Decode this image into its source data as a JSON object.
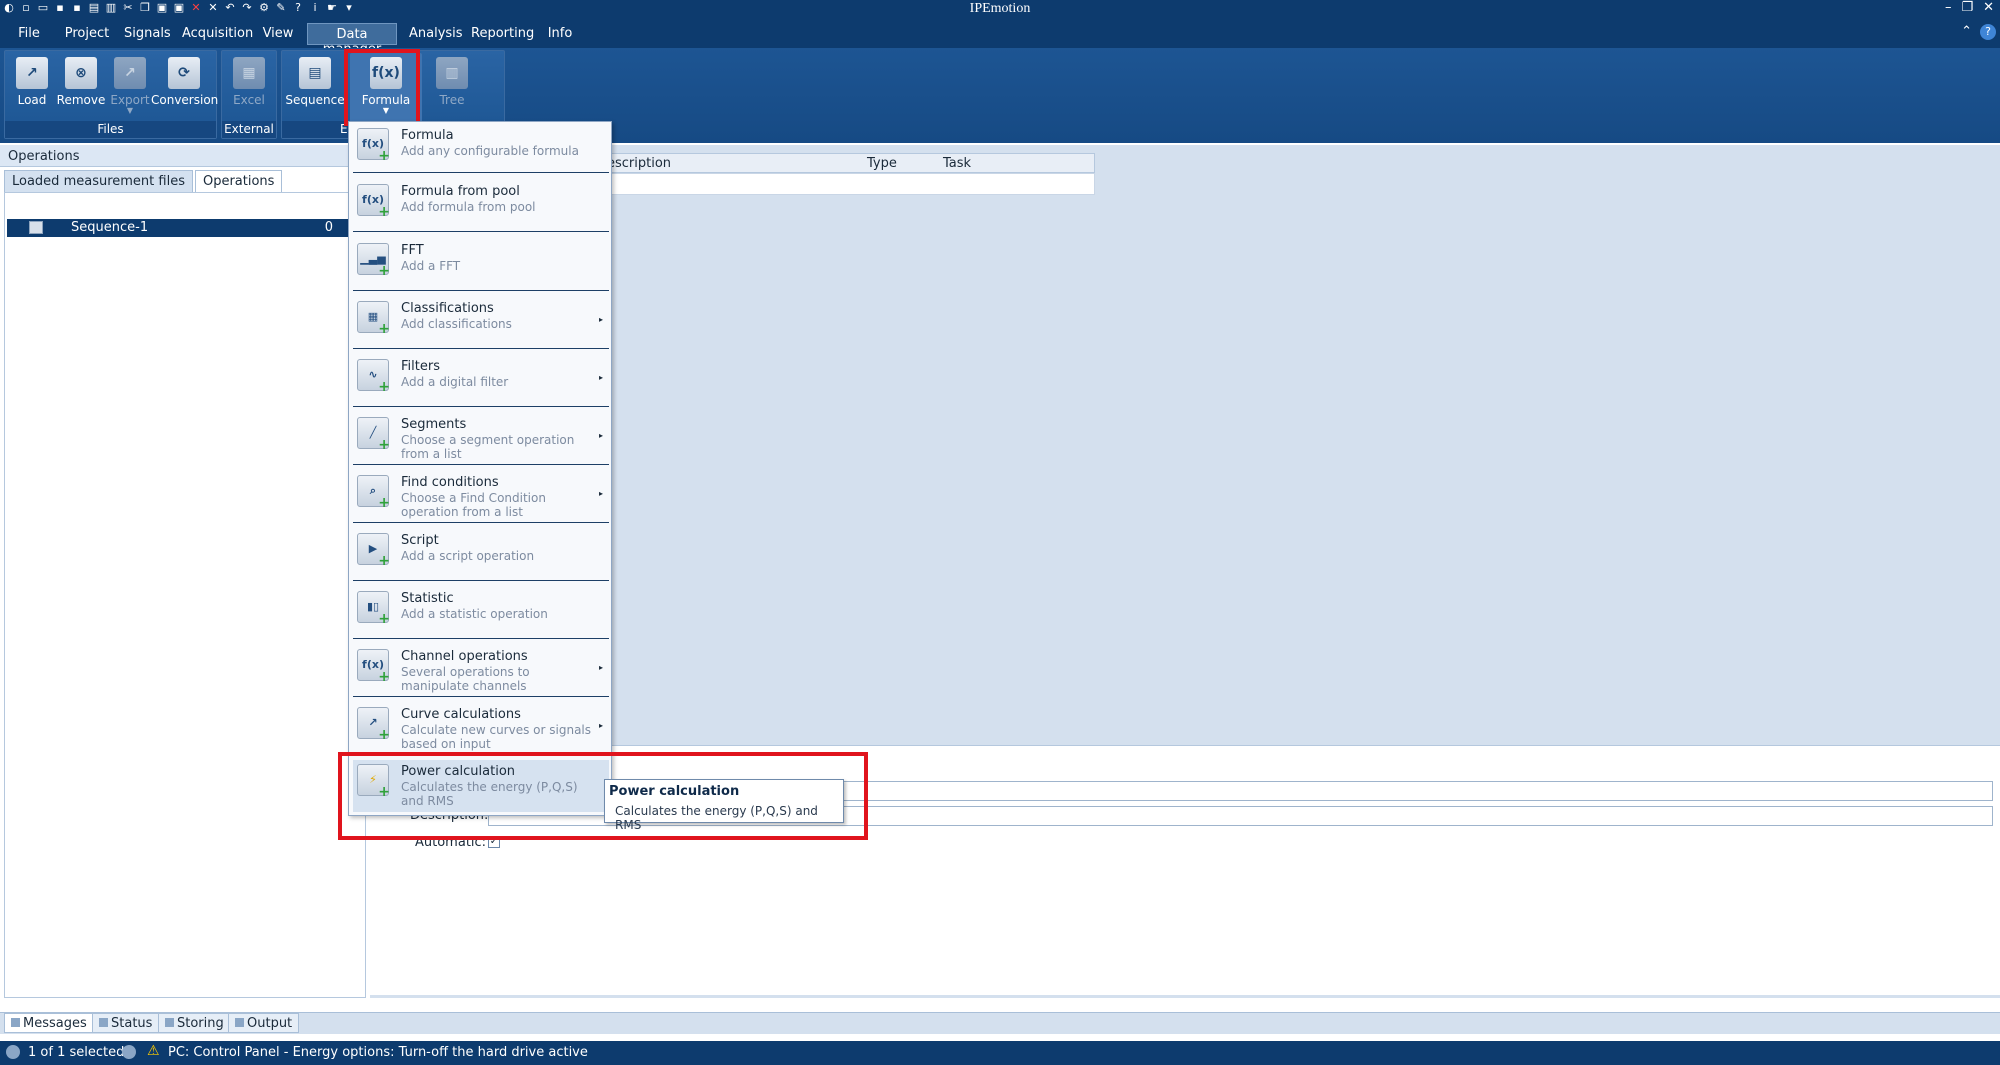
{
  "app": {
    "title": "IPEmotion",
    "window_controls": [
      "–",
      "❐",
      "✕"
    ]
  },
  "menu": {
    "items": [
      {
        "label": "File"
      },
      {
        "label": "Project"
      },
      {
        "label": "Signals"
      },
      {
        "label": "Acquisition"
      },
      {
        "label": "View"
      },
      {
        "label": "Data manager"
      },
      {
        "label": "Analysis"
      },
      {
        "label": "Reporting"
      },
      {
        "label": "Info"
      }
    ],
    "active": "Data manager"
  },
  "ribbon": {
    "groups": [
      {
        "label": "Files",
        "buttons": [
          {
            "label": "Load",
            "icon": "load-icon",
            "glyph": "↗"
          },
          {
            "label": "Remove",
            "icon": "remove-icon",
            "glyph": "⊗"
          },
          {
            "label": "Export",
            "icon": "export-icon",
            "glyph": "↗"
          },
          {
            "label": "Conversion",
            "icon": "conversion-icon",
            "glyph": "⟳"
          }
        ]
      },
      {
        "label": "External",
        "buttons": [
          {
            "label": "Excel",
            "icon": "excel-icon",
            "glyph": "▦"
          }
        ]
      },
      {
        "label": "E",
        "buttons": [
          {
            "label": "Sequence",
            "icon": "sequence-icon",
            "glyph": "▤"
          },
          {
            "label": "Formula",
            "icon": "formula-icon",
            "glyph": "f(x)"
          },
          {
            "label": "Tree",
            "icon": "tree-icon",
            "glyph": "▥"
          }
        ]
      }
    ]
  },
  "left_panel": {
    "header": "Operations",
    "tabs": [
      "Loaded measurement files",
      "Operations"
    ],
    "rows": [
      {
        "name": "Sequence-1",
        "count": "0"
      }
    ]
  },
  "table": {
    "columns": [
      "escription",
      "Type",
      "Task"
    ]
  },
  "properties": {
    "description_label": "Description:",
    "automatic_label": "Automatic:",
    "automatic_checked": "✓"
  },
  "dropdown": {
    "items": [
      {
        "title": "Formula",
        "desc": "Add any configurable formula",
        "glyph": "f(x)",
        "arrow": ""
      },
      {
        "title": "Formula from pool",
        "desc": "Add formula from pool",
        "glyph": "f(x)",
        "arrow": ""
      },
      {
        "title": "FFT",
        "desc": "Add a FFT",
        "glyph": "▁▃▅",
        "arrow": ""
      },
      {
        "title": "Classifications",
        "desc": "Add classifications",
        "glyph": "▦",
        "arrow": "▸"
      },
      {
        "title": "Filters",
        "desc": "Add a digital filter",
        "glyph": "∿",
        "arrow": "▸"
      },
      {
        "title": "Segments",
        "desc": "Choose a segment operation from a list",
        "glyph": "╱",
        "arrow": "▸"
      },
      {
        "title": "Find conditions",
        "desc": "Choose a Find Condition operation from a list",
        "glyph": "⌕",
        "arrow": "▸"
      },
      {
        "title": "Script",
        "desc": "Add a script operation",
        "glyph": "▶",
        "arrow": ""
      },
      {
        "title": "Statistic",
        "desc": "Add a statistic operation",
        "glyph": "▮▯",
        "arrow": ""
      },
      {
        "title": "Channel operations",
        "desc": "Several operations to manipulate channels",
        "glyph": "f(x)",
        "arrow": "▸"
      },
      {
        "title": "Curve calculations",
        "desc": "Calculate new curves or signals based on input",
        "glyph": "↗",
        "arrow": "▸"
      },
      {
        "title": "Power calculation",
        "desc": "Calculates the energy (P,Q,S) and RMS",
        "glyph": "⚡",
        "arrow": ""
      }
    ]
  },
  "tooltip": {
    "title": "Power calculation",
    "desc": "Calculates the energy (P,Q,S) and RMS"
  },
  "bottom_tabs": [
    "Messages",
    "Status",
    "Storing",
    "Output"
  ],
  "status": {
    "selection": "1 of 1 selected",
    "message": "PC: Control Panel - Energy options: Turn-off the hard drive active"
  },
  "colors": {
    "accent_highlight": "#e0141d",
    "titlebar": "#0d3b6e",
    "ribbon": "#1d5593"
  }
}
